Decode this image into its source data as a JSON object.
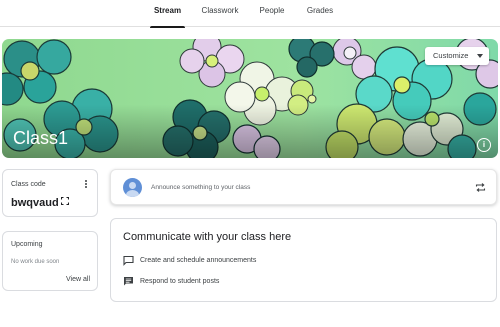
{
  "tabs": [
    {
      "label": "Stream",
      "active": true
    },
    {
      "label": "Classwork",
      "active": false
    },
    {
      "label": "People",
      "active": false
    },
    {
      "label": "Grades",
      "active": false
    }
  ],
  "banner": {
    "class_name": "Class1",
    "customize_label": "Customize",
    "info_icon": "info-icon",
    "theme_colors": [
      "#8cd98c",
      "#2aa6a0",
      "#1f6e6a",
      "#e6d1ec",
      "#c9ea7c",
      "#5fe0d0"
    ]
  },
  "class_code": {
    "label": "Class code",
    "value": "bwqvaud",
    "menu_icon": "more-vert-icon",
    "expand_icon": "fullscreen-icon"
  },
  "upcoming": {
    "title": "Upcoming",
    "empty_text": "No work due soon",
    "view_all": "View all"
  },
  "announce": {
    "placeholder": "Announce something to your class",
    "avatar_icon": "avatar-icon",
    "repost_icon": "repost-icon"
  },
  "communicate": {
    "title": "Communicate with your class here",
    "items": [
      {
        "label": "Create and schedule announcements",
        "icon": "announcement-icon"
      },
      {
        "label": "Respond to student posts",
        "icon": "comment-icon"
      }
    ]
  }
}
